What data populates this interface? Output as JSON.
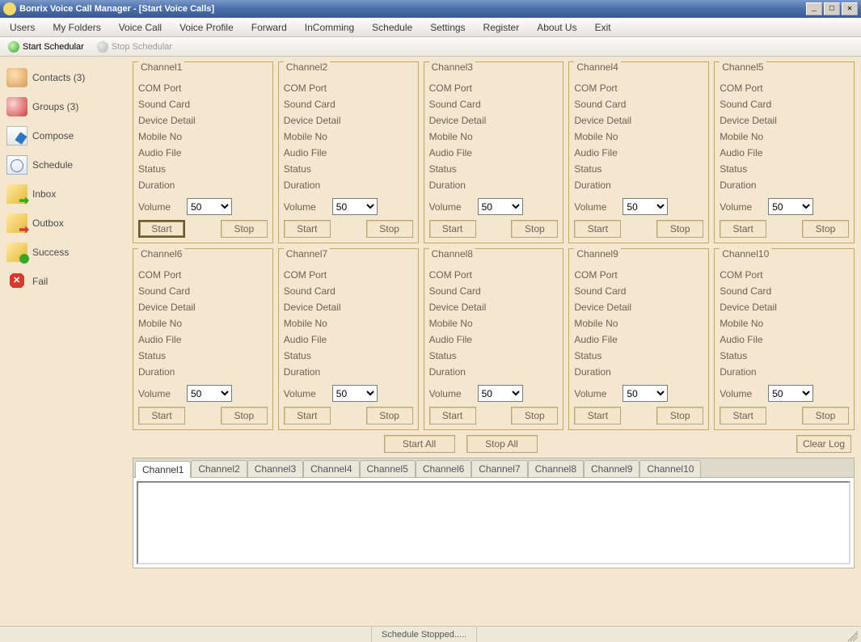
{
  "window": {
    "title": "Bonrix Voice Call Manager - [Start Voice Calls]"
  },
  "menu": {
    "items": [
      "Users",
      "My Folders",
      "Voice Call",
      "Voice Profile",
      "Forward",
      "InComming",
      "Schedule",
      "Settings",
      "Register",
      "About Us",
      "Exit"
    ]
  },
  "toolbar": {
    "start_scheduler": "Start Schedular",
    "stop_scheduler": "Stop Schedular"
  },
  "sidebar": {
    "items": [
      {
        "label": "Contacts (3)",
        "icon": "contacts"
      },
      {
        "label": "Groups (3)",
        "icon": "groups"
      },
      {
        "label": "Compose",
        "icon": "compose"
      },
      {
        "label": "Schedule",
        "icon": "schedule"
      },
      {
        "label": "Inbox",
        "icon": "inbox"
      },
      {
        "label": "Outbox",
        "icon": "outbox"
      },
      {
        "label": "Success",
        "icon": "success"
      },
      {
        "label": "Fail",
        "icon": "fail"
      }
    ]
  },
  "channel_labels": {
    "com_port": "COM Port",
    "sound_card": "Sound Card",
    "device_detail": "Device Detail",
    "mobile_no": "Mobile No",
    "audio_file": "Audio File",
    "status": "Status",
    "duration": "Duration",
    "volume": "Volume",
    "start": "Start",
    "stop": "Stop"
  },
  "channels": [
    {
      "title": "Channel1",
      "volume": "50"
    },
    {
      "title": "Channel2",
      "volume": "50"
    },
    {
      "title": "Channel3",
      "volume": "50"
    },
    {
      "title": "Channel4",
      "volume": "50"
    },
    {
      "title": "Channel5",
      "volume": "50"
    },
    {
      "title": "Channel6",
      "volume": "50"
    },
    {
      "title": "Channel7",
      "volume": "50"
    },
    {
      "title": "Channel8",
      "volume": "50"
    },
    {
      "title": "Channel9",
      "volume": "50"
    },
    {
      "title": "Channel10",
      "volume": "50"
    }
  ],
  "global_buttons": {
    "start_all": "Start All",
    "stop_all": "Stop All",
    "clear_log": "Clear Log"
  },
  "tabs": {
    "items": [
      "Channel1",
      "Channel2",
      "Channel3",
      "Channel4",
      "Channel5",
      "Channel6",
      "Channel7",
      "Channel8",
      "Channel9",
      "Channel10"
    ],
    "active_index": 0
  },
  "log": {
    "content": ""
  },
  "status": {
    "text": "Schedule Stopped....."
  },
  "window_buttons": {
    "minimize": "_",
    "maximize": "□",
    "close": "✕"
  }
}
